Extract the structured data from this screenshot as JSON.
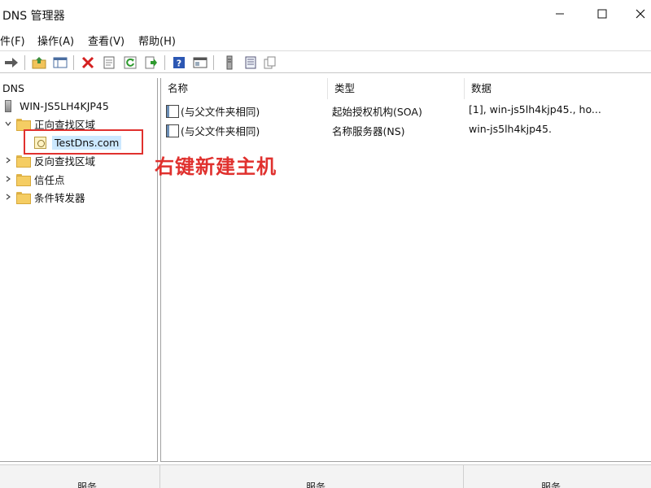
{
  "window": {
    "title": "DNS 管理器"
  },
  "menu": {
    "file": "件(F)",
    "action": "操作(A)",
    "view": "查看(V)",
    "help": "帮助(H)"
  },
  "tree": {
    "root": "DNS",
    "server": "WIN-JS5LH4KJP45",
    "forward_zone": "正向查找区域",
    "zone": "TestDns.com",
    "reverse_zone": "反向查找区域",
    "trust_points": "信任点",
    "conditional_forwarders": "条件转发器"
  },
  "list": {
    "columns": [
      "名称",
      "类型",
      "数据"
    ],
    "rows": [
      {
        "name": "(与父文件夹相同)",
        "type": "起始授权机构(SOA)",
        "data": "[1], win-js5lh4kjp45., ho..."
      },
      {
        "name": "(与父文件夹相同)",
        "type": "名称服务器(NS)",
        "data": "win-js5lh4kjp45."
      }
    ]
  },
  "annotation": {
    "text": "右键新建主机",
    "color": "#e0312e"
  },
  "status": {
    "seg1": "服务",
    "seg2": "服务",
    "seg3": "服务"
  },
  "icons": {
    "back": "arrow-left-icon",
    "forward": "arrow-right-icon",
    "up": "folder-up-icon",
    "show_tree": "show-tree-icon",
    "delete": "delete-icon",
    "properties": "properties-icon",
    "refresh": "refresh-icon",
    "export": "export-list-icon",
    "help": "help-icon",
    "console": "console-icon",
    "server": "server-icon",
    "zone_list": "zone-list-icon",
    "copy": "copy-icon"
  }
}
